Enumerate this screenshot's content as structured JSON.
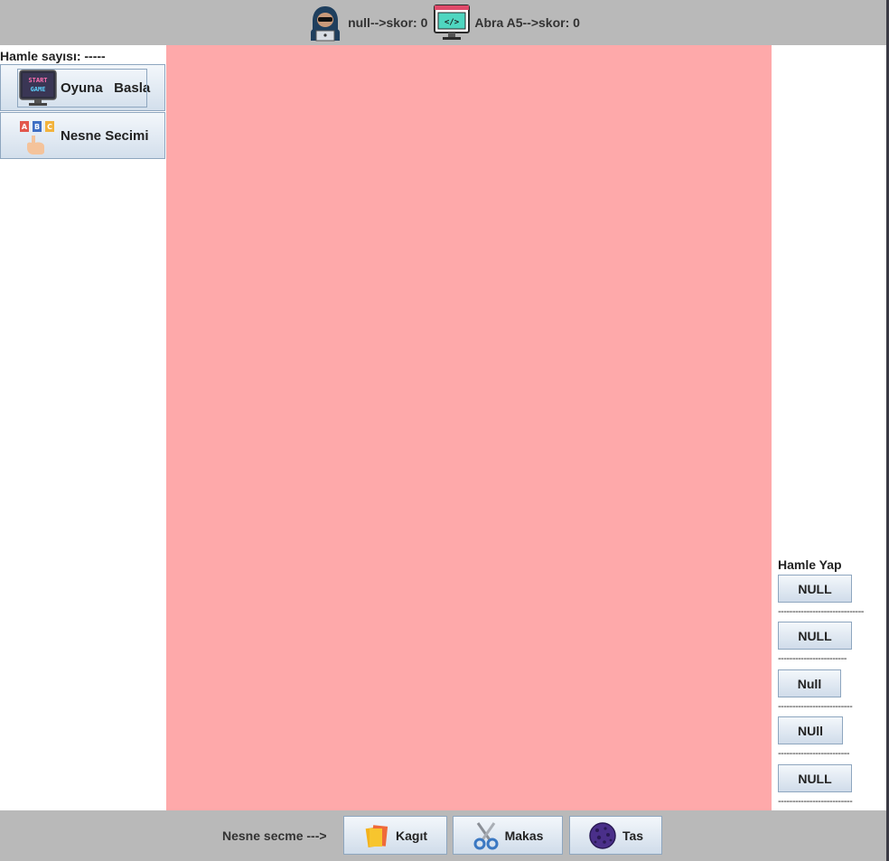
{
  "top": {
    "player1": {
      "icon": "hacker-avatar-icon",
      "label": "null-->skor: 0"
    },
    "player2": {
      "icon": "code-monitor-icon",
      "label": "Abra A5-->skor: 0"
    }
  },
  "left": {
    "move_count": "Hamle sayısı: -----",
    "start_button": {
      "icon": "start-game-icon",
      "icon_text": "START GAME",
      "label": "Oyuna   Basla"
    },
    "select_button": {
      "icon": "abc-blocks-hand-icon",
      "label": "Nesne Secimi"
    }
  },
  "right": {
    "title": "Hamle Yap",
    "buttons": [
      "NULL",
      "NULL",
      "Null",
      "NUll",
      "NULL"
    ],
    "separators": [
      "------------------------------",
      "------------------------",
      "--------------------------",
      "-------------------------",
      "--------------------------"
    ]
  },
  "bottom": {
    "label": "Nesne secme --->",
    "buttons": [
      {
        "icon": "paper-icon",
        "label": "Kagıt"
      },
      {
        "icon": "scissors-icon",
        "label": "Makas"
      },
      {
        "icon": "rock-icon",
        "label": "Tas"
      }
    ]
  },
  "colors": {
    "board": "#fea9aa",
    "bar": "#b9b9b9"
  }
}
